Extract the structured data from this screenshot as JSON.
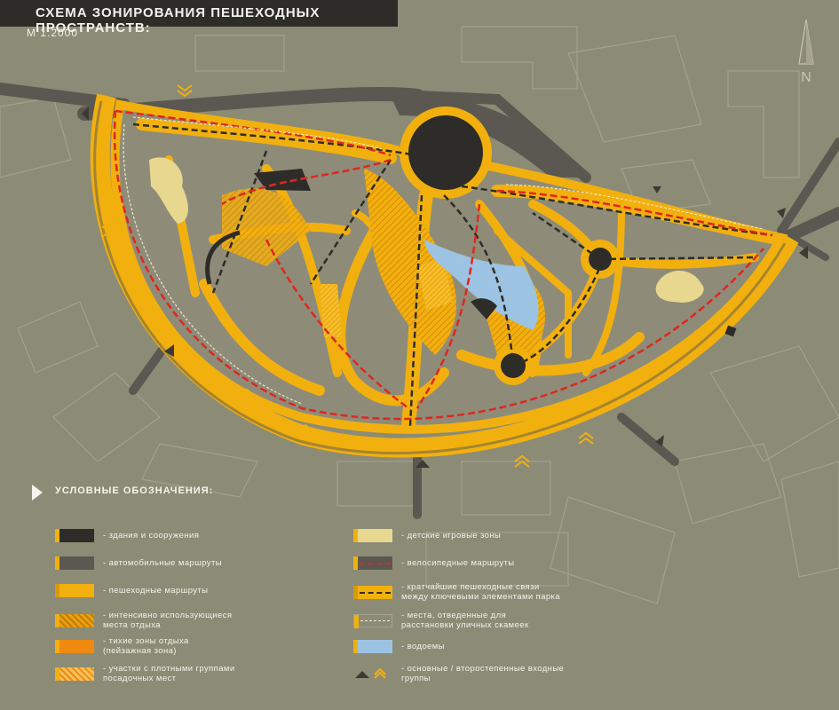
{
  "header": {
    "title": "СХЕМА ЗОНИРОВАНИЯ ПЕШЕХОДНЫХ ПРОСТРАНСТВ:",
    "scale": "М  1:2000"
  },
  "map": {
    "north_label": "N",
    "colors": {
      "background": "#8c8b76",
      "buildings": "#2e2c28",
      "roads": "#5a5850",
      "pedestrian": "#f2b00f",
      "active_rest": "#e8a010",
      "quiet_zone": "#ee8a10",
      "planting": "#f4c15a",
      "kids": "#e8d78e",
      "bike_route": "#e0261f",
      "shortcut": "#2e2c28",
      "benches": "#f4f0d0",
      "water": "#9cc3e2"
    }
  },
  "legend": {
    "title": "УСЛОВНЫЕ  ОБОЗНАЧЕНИЯ:",
    "left": [
      {
        "label": "- здания  и  сооружения",
        "icon": "buildings-swatch"
      },
      {
        "label": "- автомобильные  маршруты",
        "icon": "roads-swatch"
      },
      {
        "label": "- пешеходные  маршруты",
        "icon": "pedestrian-swatch"
      },
      {
        "label": "- интенсивно  использующиеся\nместа  отдыха",
        "icon": "active-rest-swatch"
      },
      {
        "label": "- тихие  зоны  отдыха\n(пейзажная  зона)",
        "icon": "quiet-zone-swatch"
      },
      {
        "label": "- участки  с  плотными  группами\nпосадочных  мест",
        "icon": "planting-swatch"
      }
    ],
    "right": [
      {
        "label": "- детские  игровые  зоны",
        "icon": "kids-swatch"
      },
      {
        "label": "- велосипедные  маршруты",
        "icon": "bike-swatch"
      },
      {
        "label": "- кратчайшие  пешеходные  связи\nмежду  ключевыми  элементами  парка",
        "icon": "shortcut-swatch"
      },
      {
        "label": "- места,  отведенные  для\nрасстановки  уличных  скамеек",
        "icon": "benches-swatch"
      },
      {
        "label": "- водоемы",
        "icon": "water-swatch"
      },
      {
        "label": "- основные / второстепенные  входные\nгруппы",
        "icon": "entrance-swatch"
      }
    ]
  }
}
